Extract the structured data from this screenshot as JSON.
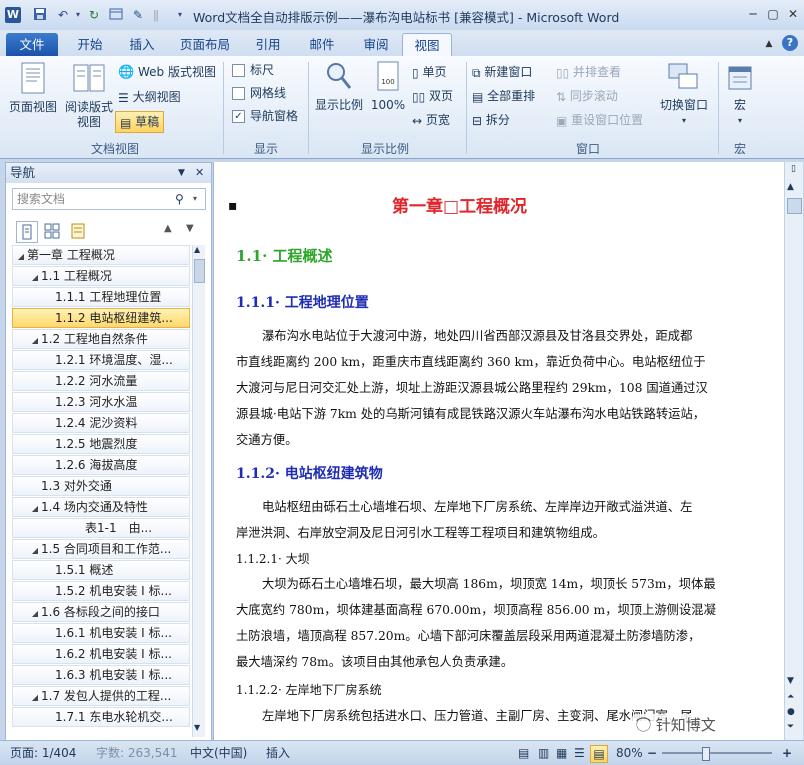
{
  "window": {
    "title": "Word文档全自动排版示例——瀑布沟电站标书 [兼容模式] - Microsoft Word"
  },
  "tabs": [
    "文件",
    "开始",
    "插入",
    "页面布局",
    "引用",
    "邮件",
    "审阅",
    "视图"
  ],
  "ribbon": {
    "doc_views": {
      "print_layout": "页面视图",
      "reading_1": "阅读版式",
      "reading_2": "视图",
      "web_layout": "Web 版式视图",
      "outline": "大纲视图",
      "draft": "草稿",
      "label": "文档视图"
    },
    "show": {
      "ruler": "标尺",
      "gridlines": "网格线",
      "nav_pane": "导航窗格",
      "label": "显示",
      "nav_pane_checked": true
    },
    "zoom": {
      "zoom_btn": "显示比例",
      "hundred": "100%",
      "one_page": "单页",
      "two_pages": "双页",
      "page_width": "页宽",
      "label": "显示比例"
    },
    "window": {
      "new_window": "新建窗口",
      "arrange_all": "全部重排",
      "split": "拆分",
      "side_by_side": "并排查看",
      "sync_scroll": "同步滚动",
      "reset_pos": "重设窗口位置",
      "switch_windows": "切换窗口",
      "label": "窗口"
    },
    "macros": {
      "macro": "宏",
      "label": "宏"
    }
  },
  "nav": {
    "title": "导航",
    "search_placeholder": "搜索文档",
    "tree": [
      {
        "label": "第一章 工程概况",
        "level": 0,
        "expanded": true
      },
      {
        "label": "1.1 工程概况",
        "level": 1,
        "expanded": true
      },
      {
        "label": "1.1.1 工程地理位置",
        "level": 2
      },
      {
        "label": "1.1.2 电站枢纽建筑...",
        "level": 2,
        "selected": true
      },
      {
        "label": "1.2 工程地自然条件",
        "level": 1,
        "expanded": true
      },
      {
        "label": "1.2.1 环境温度、湿...",
        "level": 2
      },
      {
        "label": "1.2.2 河水流量",
        "level": 2
      },
      {
        "label": "1.2.3 河水水温",
        "level": 2
      },
      {
        "label": "1.2.4 泥沙资料",
        "level": 2
      },
      {
        "label": "1.2.5 地震烈度",
        "level": 2
      },
      {
        "label": "1.2.6 海拔高度",
        "level": 2
      },
      {
        "label": "1.3 对外交通",
        "level": 1
      },
      {
        "label": "1.4 场内交通及特性",
        "level": 1,
        "expanded": true
      },
      {
        "label": "表1-1　由...",
        "level": 3
      },
      {
        "label": "1.5 合同项目和工作范...",
        "level": 1,
        "expanded": true
      },
      {
        "label": "1.5.1 概述",
        "level": 2
      },
      {
        "label": "1.5.2 机电安装 I 标...",
        "level": 2
      },
      {
        "label": "1.6 各标段之间的接口",
        "level": 1,
        "expanded": true
      },
      {
        "label": "1.6.1 机电安装 I 标...",
        "level": 2
      },
      {
        "label": "1.6.2 机电安装 I 标...",
        "level": 2
      },
      {
        "label": "1.6.3 机电安装 I 标...",
        "level": 2
      },
      {
        "label": "1.7 发包人提供的工程...",
        "level": 1,
        "expanded": true
      },
      {
        "label": "1.7.1 东电水轮机交...",
        "level": 2
      }
    ]
  },
  "doc": {
    "chapter_title": "第一章□工程概况",
    "h1_1": "1.1· 工程概述",
    "h1_1_1": "1.1.1· 工程地理位置",
    "p1": [
      "瀑布沟水电站位于大渡河中游，地处四川省西部汉源县及甘洛县交界处，距成都",
      "市直线距离约 200 km，距重庆市直线距离约 360 km，靠近负荷中心。电站枢纽位于",
      "大渡河与尼日河交汇处上游，坝址上游距汉源县城公路里程约 29km，108 国道通过汉",
      "源县城·电站下游 7km 处的乌斯河镇有成昆铁路汉源火车站瀑布沟水电站铁路转运站，",
      "交通方便。"
    ],
    "h1_1_2": "1.1.2· 电站枢纽建筑物",
    "p2": [
      "电站枢纽由砾石土心墙堆石坝、左岸地下厂房系统、左岸岸边开敞式溢洪道、左",
      "岸泄洪洞、右岸放空洞及尼日河引水工程等工程项目和建筑物组成。"
    ],
    "h_dam": "1.1.2.1· 大坝",
    "p3": [
      "大坝为砾石土心墙堆石坝，最大坝高 186m，坝顶宽 14m，坝顶长 573m，坝体最",
      "大底宽约 780m，坝体建基面高程 670.00m，坝顶高程 856.00 m，坝顶上游侧设混凝",
      "土防浪墙，墙顶高程  857.20m。心墙下部河床覆盖层段采用两道混凝土防渗墙防渗，",
      "最大墙深约 78m。该项目由其他承包人负责承建。"
    ],
    "h_plant": "1.1.2.2· 左岸地下厂房系统",
    "p4": "左岸地下厂房系统包括进水口、压力管道、主副厂房、主变洞、尾水闸门室、尾"
  },
  "status": {
    "page": "页面: 1/404",
    "words": "字数: 263,541",
    "lang": "中文(中国)",
    "insert": "插入",
    "zoom": "80%",
    "zoom_fraction": 0.8
  },
  "watermark": "针知博文",
  "colors": {
    "chapter": "#e0262a",
    "h1": "#2ea52b",
    "h2": "#1e2db4",
    "selected": "#ffd86a"
  }
}
